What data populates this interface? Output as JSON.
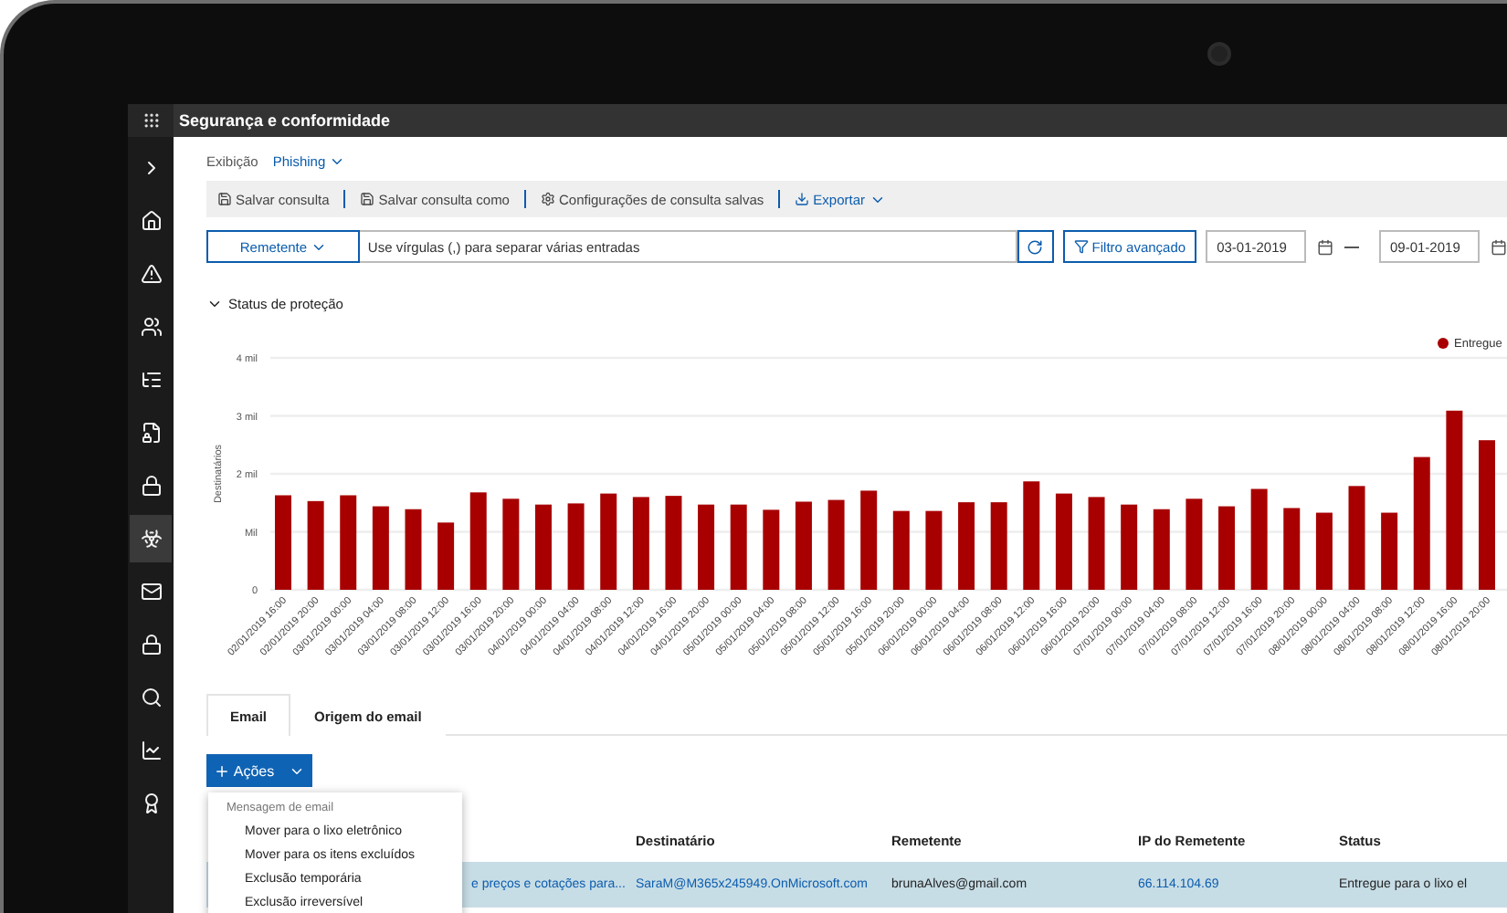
{
  "app_bar": {
    "title": "Segurança e conformidade"
  },
  "sidebar": {
    "items": [
      {
        "kind": "expand",
        "selected": false
      },
      {
        "kind": "home",
        "selected": false
      },
      {
        "kind": "alert",
        "selected": false
      },
      {
        "kind": "people",
        "selected": false
      },
      {
        "kind": "list",
        "selected": false
      },
      {
        "kind": "document",
        "selected": false
      },
      {
        "kind": "lock",
        "selected": false
      },
      {
        "kind": "biohazard",
        "selected": true
      },
      {
        "kind": "mail",
        "selected": false
      },
      {
        "kind": "lock",
        "selected": false
      },
      {
        "kind": "search",
        "selected": false
      },
      {
        "kind": "chart",
        "selected": false
      },
      {
        "kind": "badge",
        "selected": false
      }
    ]
  },
  "view": {
    "label": "Exibição",
    "value": "Phishing"
  },
  "toolbar": {
    "items": [
      {
        "kind": "save",
        "label": "Salvar consulta"
      },
      {
        "kind": "save",
        "label": "Salvar consulta como"
      },
      {
        "kind": "settings",
        "label": "Configurações de consulta salvas"
      },
      {
        "kind": "export",
        "label": "Exportar"
      }
    ]
  },
  "filter": {
    "field_selector": "Remetente",
    "placeholder": "Use vírgulas (,) para separar várias entradas",
    "advanced_filter": "Filtro avançado",
    "start_date": "03-01-2019",
    "end_date": "09-01-2019"
  },
  "section": {
    "title": "Status de proteção",
    "expanded": true,
    "chart_data": {
      "type": "bar",
      "ylabel": "Destinatários",
      "grid": true,
      "categories": [
        "02/01/2019 16:00",
        "02/01/2019 20:00",
        "03/01/2019 00:00",
        "03/01/2019 04:00",
        "03/01/2019 08:00",
        "03/01/2019 12:00",
        "03/01/2019 16:00",
        "03/01/2019 20:00",
        "04/01/2019 00:00",
        "04/01/2019 04:00",
        "04/01/2019 08:00",
        "04/01/2019 12:00",
        "04/01/2019 16:00",
        "04/01/2019 20:00",
        "05/01/2019 00:00",
        "05/01/2019 04:00",
        "05/01/2019 08:00",
        "05/01/2019 12:00",
        "05/01/2019 16:00",
        "05/01/2019 20:00",
        "06/01/2019 00:00",
        "06/01/2019 04:00",
        "06/01/2019 08:00",
        "06/01/2019 12:00",
        "06/01/2019 16:00",
        "06/01/2019 20:00",
        "07/01/2019 00:00",
        "07/01/2019 04:00",
        "07/01/2019 08:00",
        "07/01/2019 12:00",
        "07/01/2019 16:00",
        "07/01/2019 20:00",
        "08/01/2019 00:00",
        "08/01/2019 04:00",
        "08/01/2019 08:00",
        "08/01/2019 12:00",
        "08/01/2019 16:00",
        "08/01/2019 20:00"
      ],
      "series": [
        {
          "name": "Entregue",
          "color": "#a80000",
          "values": [
            1.63,
            1.53,
            1.63,
            1.44,
            1.39,
            1.16,
            1.68,
            1.57,
            1.47,
            1.49,
            1.66,
            1.6,
            1.62,
            1.47,
            1.47,
            1.38,
            1.52,
            1.55,
            1.71,
            1.36,
            1.36,
            1.51,
            1.51,
            1.87,
            1.66,
            1.6,
            1.47,
            1.39,
            1.57,
            1.44,
            1.74,
            1.41,
            1.33,
            1.79,
            1.33,
            2.29,
            3.09,
            2.58
          ]
        }
      ],
      "ylim": [
        0,
        4
      ],
      "yticks": [
        0,
        {
          "value": 1,
          "label": "Mil"
        },
        {
          "value": 2,
          "label": "2 mil"
        },
        {
          "value": 3,
          "label": "3 mil"
        },
        {
          "value": 4,
          "label": "4 mil"
        }
      ]
    }
  },
  "tabs": [
    {
      "label": "Email",
      "selected": true
    },
    {
      "label": "Origem do email",
      "selected": false
    }
  ],
  "actions_button": {
    "label": "Ações"
  },
  "actions_menu": {
    "heading": "Mensagem de email",
    "items": [
      "Mover para o lixo eletrônico",
      "Mover para os itens excluídos",
      "Exclusão temporária",
      "Exclusão irreversível"
    ]
  },
  "table": {
    "columns": [
      "",
      "Destinatário",
      "Remetente",
      "IP do Remetente",
      "Status"
    ],
    "rows": [
      {
        "selected": true,
        "cells": [
          {
            "text": "e preços e cotações para...",
            "link": true
          },
          {
            "text": "SaraM@M365x245949.OnMicrosoft.com",
            "link": true
          },
          {
            "text": "brunaAlves@gmail.com",
            "link": false
          },
          {
            "text": "66.114.104.69",
            "link": true
          },
          {
            "text": "Entregue para o lixo el",
            "link": false
          }
        ]
      }
    ]
  }
}
